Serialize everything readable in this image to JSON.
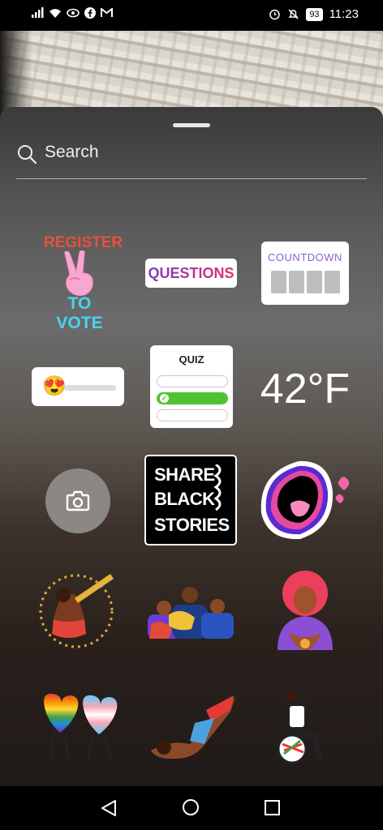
{
  "status_bar": {
    "battery": "93",
    "time": "11:23"
  },
  "search": {
    "placeholder": "Search"
  },
  "stickers": {
    "register": {
      "top": "REGISTER",
      "bottom": "TO VOTE"
    },
    "questions": {
      "label": "QUESTIONS"
    },
    "countdown": {
      "label": "COUNTDOWN"
    },
    "quiz": {
      "label": "QUIZ"
    },
    "temperature": {
      "label": "42°F"
    },
    "share_black_stories": {
      "line1": "SHARE",
      "line2": "BLACK",
      "line3": "STORIES"
    },
    "slider_emoji": "😍"
  },
  "icons": {
    "status_left": [
      "signal-icon",
      "wifi-icon",
      "eye-icon",
      "facebook-icon",
      "gmail-icon"
    ],
    "status_right": [
      "alarm-icon",
      "mute-icon",
      "battery-icon"
    ],
    "nav": [
      "back-icon",
      "home-icon",
      "recents-icon"
    ]
  },
  "colors": {
    "questions_gradient": [
      "#7d3ac1",
      "#e1306c"
    ],
    "countdown_text": "#8a5fcf",
    "quiz_correct": "#52c233",
    "register_top": "#e8503a",
    "register_bottom": "#49d3f0"
  }
}
